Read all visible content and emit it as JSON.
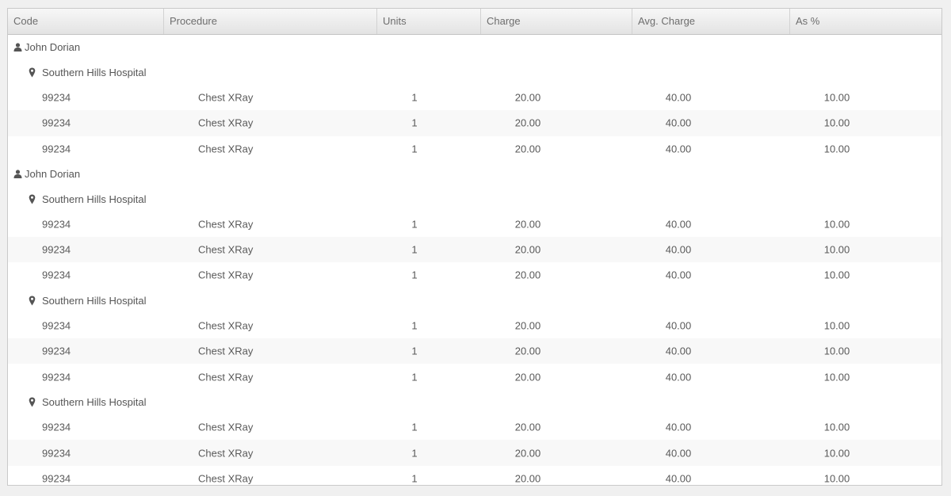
{
  "columns": {
    "code": "Code",
    "procedure": "Procedure",
    "units": "Units",
    "charge": "Charge",
    "avg_charge": "Avg. Charge",
    "as_pct": "As %"
  },
  "groups": [
    {
      "user_icon": "person-icon",
      "user": "John Dorian",
      "locations": [
        {
          "location_icon": "map-pin-icon",
          "name": "Southern Hills Hospital",
          "rows": [
            {
              "code": "99234",
              "procedure": "Chest XRay",
              "units": "1",
              "charge": "20.00",
              "avg_charge": "40.00",
              "as_pct": "10.00"
            },
            {
              "code": "99234",
              "procedure": "Chest XRay",
              "units": "1",
              "charge": "20.00",
              "avg_charge": "40.00",
              "as_pct": "10.00"
            },
            {
              "code": "99234",
              "procedure": "Chest XRay",
              "units": "1",
              "charge": "20.00",
              "avg_charge": "40.00",
              "as_pct": "10.00"
            }
          ]
        }
      ]
    },
    {
      "user_icon": "person-icon",
      "user": "John Dorian",
      "locations": [
        {
          "location_icon": "map-pin-icon",
          "name": "Southern Hills Hospital",
          "rows": [
            {
              "code": "99234",
              "procedure": "Chest XRay",
              "units": "1",
              "charge": "20.00",
              "avg_charge": "40.00",
              "as_pct": "10.00"
            },
            {
              "code": "99234",
              "procedure": "Chest XRay",
              "units": "1",
              "charge": "20.00",
              "avg_charge": "40.00",
              "as_pct": "10.00"
            },
            {
              "code": "99234",
              "procedure": "Chest XRay",
              "units": "1",
              "charge": "20.00",
              "avg_charge": "40.00",
              "as_pct": "10.00"
            }
          ]
        },
        {
          "location_icon": "map-pin-icon",
          "name": "Southern Hills Hospital",
          "rows": [
            {
              "code": "99234",
              "procedure": "Chest XRay",
              "units": "1",
              "charge": "20.00",
              "avg_charge": "40.00",
              "as_pct": "10.00"
            },
            {
              "code": "99234",
              "procedure": "Chest XRay",
              "units": "1",
              "charge": "20.00",
              "avg_charge": "40.00",
              "as_pct": "10.00"
            },
            {
              "code": "99234",
              "procedure": "Chest XRay",
              "units": "1",
              "charge": "20.00",
              "avg_charge": "40.00",
              "as_pct": "10.00"
            }
          ]
        },
        {
          "location_icon": "map-pin-icon",
          "name": "Southern Hills Hospital",
          "rows": [
            {
              "code": "99234",
              "procedure": "Chest XRay",
              "units": "1",
              "charge": "20.00",
              "avg_charge": "40.00",
              "as_pct": "10.00"
            },
            {
              "code": "99234",
              "procedure": "Chest XRay",
              "units": "1",
              "charge": "20.00",
              "avg_charge": "40.00",
              "as_pct": "10.00"
            },
            {
              "code": "99234",
              "procedure": "Chest XRay",
              "units": "1",
              "charge": "20.00",
              "avg_charge": "40.00",
              "as_pct": "10.00"
            }
          ]
        }
      ]
    }
  ],
  "colors": {
    "header_text": "#6e6e6e",
    "row_text": "#5a5a5a",
    "alt_row": "#f8f8f8",
    "icon": "#555555"
  }
}
